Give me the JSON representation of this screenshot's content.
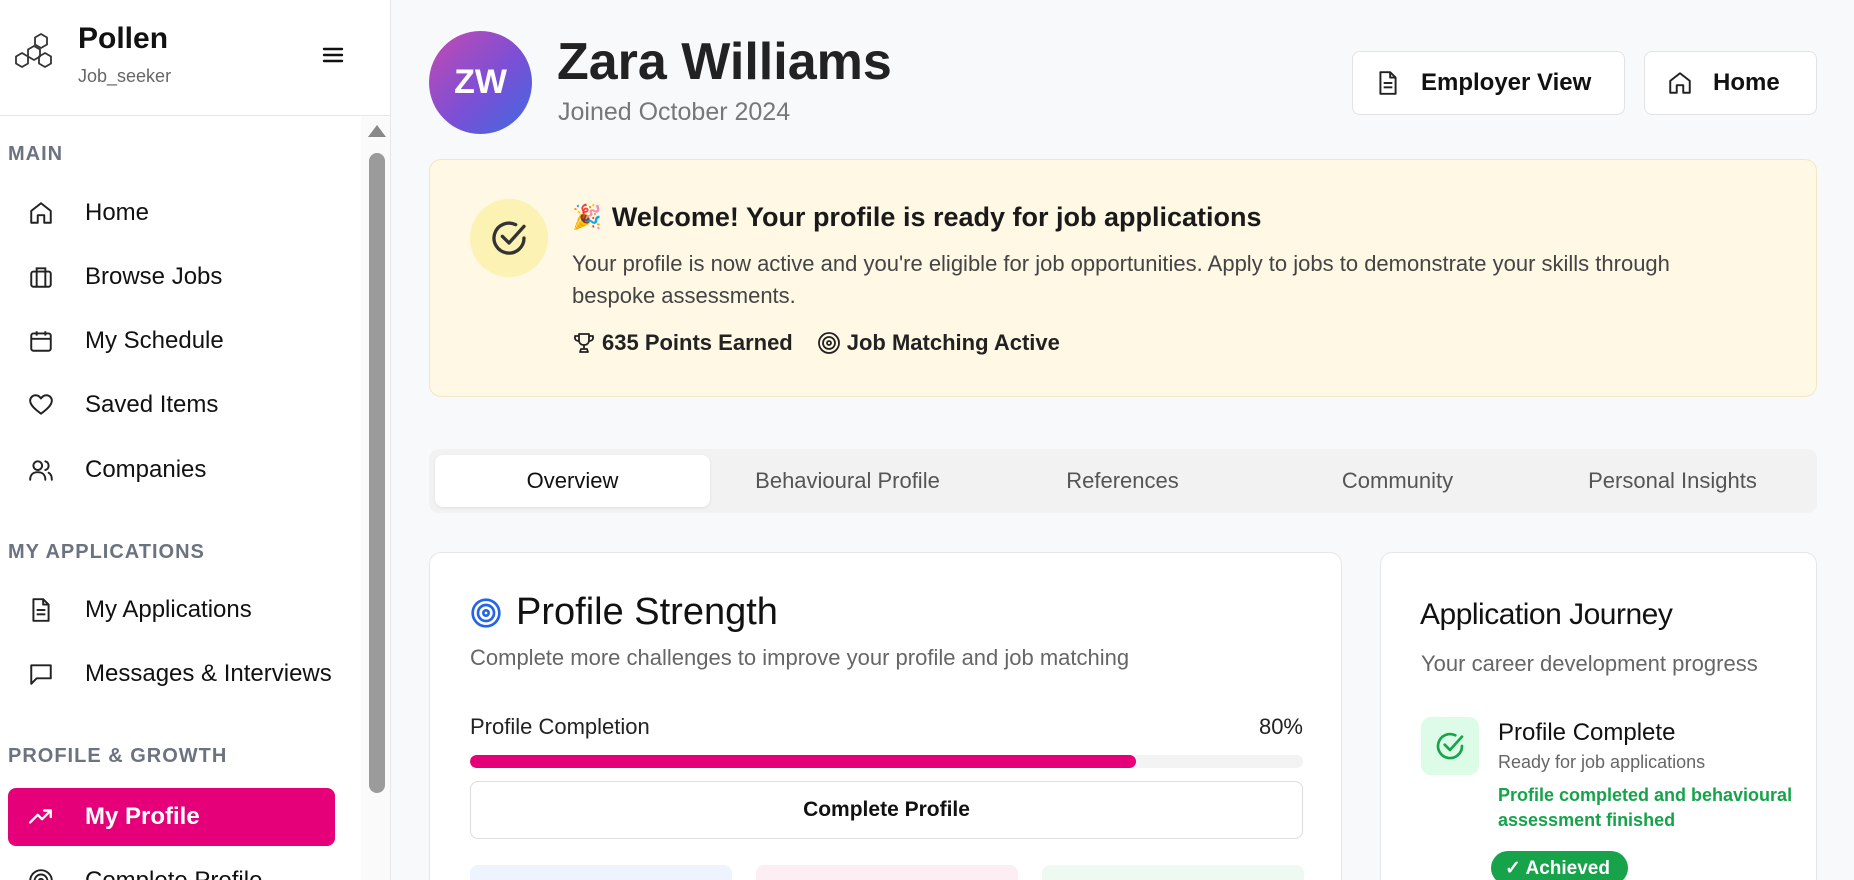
{
  "brand": {
    "name": "Pollen",
    "role": "Job_seeker"
  },
  "sidebar": {
    "sections": [
      {
        "title": "MAIN"
      },
      {
        "title": "MY APPLICATIONS"
      },
      {
        "title": "PROFILE & GROWTH"
      }
    ],
    "items": [
      {
        "label": "Home",
        "icon": "home-icon"
      },
      {
        "label": "Browse Jobs",
        "icon": "briefcase-icon"
      },
      {
        "label": "My Schedule",
        "icon": "calendar-icon"
      },
      {
        "label": "Saved Items",
        "icon": "heart-icon"
      },
      {
        "label": "Companies",
        "icon": "users-icon"
      },
      {
        "label": "My Applications",
        "icon": "document-icon"
      },
      {
        "label": "Messages & Interviews",
        "icon": "message-icon"
      },
      {
        "label": "My Profile",
        "icon": "trending-up-icon",
        "active": true
      },
      {
        "label": "Complete Profile",
        "icon": "target-icon"
      }
    ]
  },
  "header": {
    "initials": "ZW",
    "name": "Zara Williams",
    "joined": "Joined October 2024",
    "employer_view_label": "Employer View",
    "home_label": "Home"
  },
  "banner": {
    "emoji": "🎉",
    "title": "Welcome! Your profile is ready for job applications",
    "text": "Your profile is now active and you're eligible for job opportunities. Apply to jobs to demonstrate your skills through bespoke assessments.",
    "points": "635 Points Earned",
    "matching": "Job Matching Active"
  },
  "tabs": [
    {
      "label": "Overview",
      "active": true
    },
    {
      "label": "Behavioural Profile"
    },
    {
      "label": "References"
    },
    {
      "label": "Community"
    },
    {
      "label": "Personal Insights"
    }
  ],
  "profile_strength": {
    "title": "Profile Strength",
    "subtitle": "Complete more challenges to improve your profile and job matching",
    "completion_label": "Profile Completion",
    "completion_value": "80%",
    "completion_fraction": 0.8,
    "button_label": "Complete Profile"
  },
  "journey": {
    "title": "Application Journey",
    "subtitle": "Your career development progress",
    "step_title": "Profile Complete",
    "step_sub": "Ready for job applications",
    "step_note": "Profile completed and behavioural assessment finished",
    "badge": "✓ Achieved"
  },
  "colors": {
    "accent": "#e5007a",
    "success": "#16a34a",
    "banner_bg": "#fef8e5"
  }
}
